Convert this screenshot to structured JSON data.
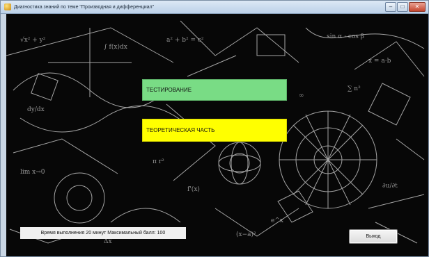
{
  "window": {
    "title": "Диагностика знаний по теме \"Производная и дифференциал\"",
    "min_glyph": "–",
    "max_glyph": "□",
    "close_glyph": "✕"
  },
  "main": {
    "testing_button_label": "ТЕСТИРОВАНИЕ",
    "theory_button_label": "ТЕОРЕТИЧЕСКАЯ ЧАСТЬ",
    "info_text": "Время выполнения 20 минут  Максимальный балл: 100",
    "exit_button_label": "Выход"
  },
  "colors": {
    "testing_button": "#79dc85",
    "theory_button": "#ffff00",
    "background": "#070707"
  },
  "icons": {
    "app": "app-icon"
  }
}
